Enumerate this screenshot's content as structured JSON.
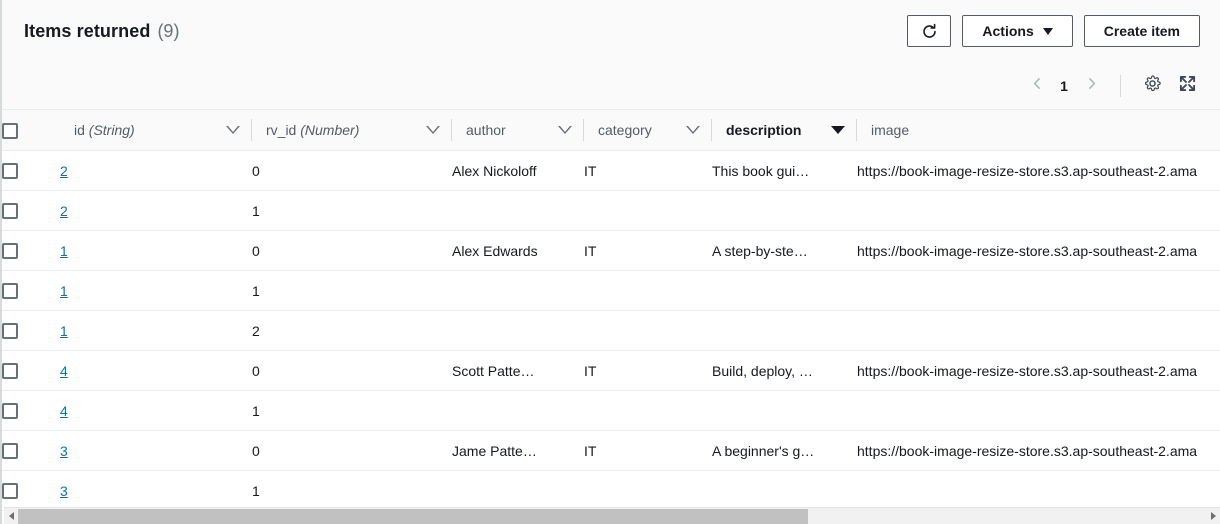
{
  "header": {
    "title": "Items returned",
    "count": "(9)",
    "refresh_icon": "refresh-icon",
    "actions_label": "Actions",
    "create_label": "Create item"
  },
  "tools": {
    "prev_icon": "chevron-left-icon",
    "page_number": "1",
    "next_icon": "chevron-right-icon",
    "settings_icon": "gear-icon",
    "fullscreen_icon": "expand-icon"
  },
  "table": {
    "columns": [
      {
        "key": "id",
        "label": "id",
        "type": "(String)",
        "sorted": false
      },
      {
        "key": "rv_id",
        "label": "rv_id",
        "type": "(Number)",
        "sorted": false
      },
      {
        "key": "author",
        "label": "author",
        "type": "",
        "sorted": false
      },
      {
        "key": "category",
        "label": "category",
        "type": "",
        "sorted": false
      },
      {
        "key": "description",
        "label": "description",
        "type": "",
        "sorted": true
      },
      {
        "key": "image",
        "label": "image",
        "type": "",
        "sorted": false
      }
    ],
    "rows": [
      {
        "id": "2",
        "rv_id": "0",
        "author": "Alex Nickoloff",
        "category": "IT",
        "description": "This book gui…",
        "image": "https://book-image-resize-store.s3.ap-southeast-2.ama"
      },
      {
        "id": "2",
        "rv_id": "1",
        "author": "",
        "category": "",
        "description": "",
        "image": ""
      },
      {
        "id": "1",
        "rv_id": "0",
        "author": "Alex Edwards",
        "category": "IT",
        "description": "A step-by-ste…",
        "image": "https://book-image-resize-store.s3.ap-southeast-2.ama"
      },
      {
        "id": "1",
        "rv_id": "1",
        "author": "",
        "category": "",
        "description": "",
        "image": ""
      },
      {
        "id": "1",
        "rv_id": "2",
        "author": "",
        "category": "",
        "description": "",
        "image": ""
      },
      {
        "id": "4",
        "rv_id": "0",
        "author": "Scott Patte…",
        "category": "IT",
        "description": "Build, deploy, …",
        "image": "https://book-image-resize-store.s3.ap-southeast-2.ama"
      },
      {
        "id": "4",
        "rv_id": "1",
        "author": "",
        "category": "",
        "description": "",
        "image": ""
      },
      {
        "id": "3",
        "rv_id": "0",
        "author": "Jame Patte…",
        "category": "IT",
        "description": "A beginner's g…",
        "image": "https://book-image-resize-store.s3.ap-southeast-2.ama"
      },
      {
        "id": "3",
        "rv_id": "1",
        "author": "",
        "category": "",
        "description": "",
        "image": ""
      }
    ]
  },
  "scrollbar": {
    "left_arrow_icon": "scroll-left-icon",
    "right_arrow_icon": "scroll-right-icon"
  },
  "colors": {
    "link": "#0073bb",
    "text": "#16191f",
    "muted": "#687078",
    "border": "#eaeded",
    "header_bg": "#fafafa"
  }
}
